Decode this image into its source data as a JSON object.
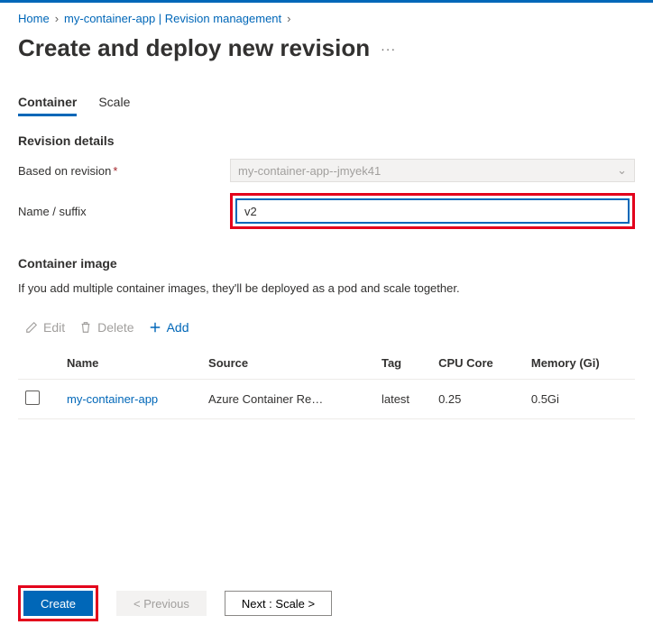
{
  "breadcrumb": {
    "home": "Home",
    "app": "my-container-app | Revision management"
  },
  "title": "Create and deploy new revision",
  "tabs": {
    "container": "Container",
    "scale": "Scale"
  },
  "revision": {
    "section_label": "Revision details",
    "based_on_label": "Based on revision",
    "based_on_value": "my-container-app--jmyek41",
    "suffix_label": "Name / suffix",
    "suffix_value": "v2"
  },
  "image": {
    "section_label": "Container image",
    "description": "If you add multiple container images, they'll be deployed as a pod and scale together."
  },
  "toolbar": {
    "edit": "Edit",
    "delete": "Delete",
    "add": "Add"
  },
  "table": {
    "headers": {
      "name": "Name",
      "source": "Source",
      "tag": "Tag",
      "cpu": "CPU Core",
      "memory": "Memory (Gi)"
    },
    "rows": [
      {
        "name": "my-container-app",
        "source": "Azure Container Re…",
        "tag": "latest",
        "cpu": "0.25",
        "memory": "0.5Gi"
      }
    ]
  },
  "footer": {
    "create": "Create",
    "previous": "< Previous",
    "next": "Next : Scale >"
  }
}
